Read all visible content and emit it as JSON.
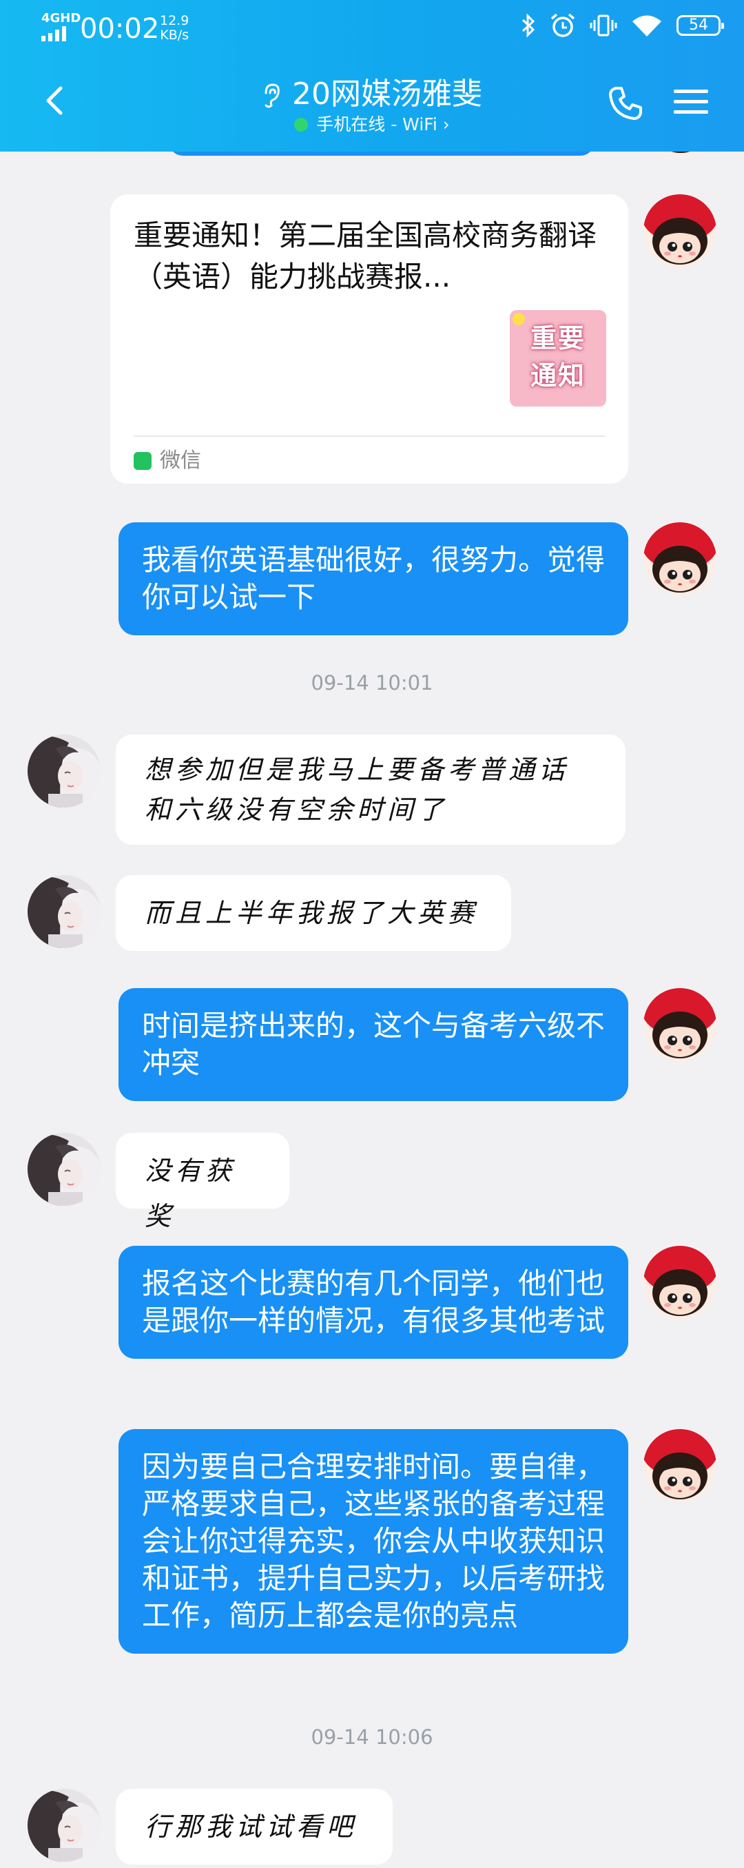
{
  "status_bar": {
    "network": "4GHD",
    "time": "00:02",
    "speed_value": "12.9",
    "speed_unit": "KB/s",
    "battery": "54",
    "icons": [
      "bluetooth-icon",
      "alarm-icon",
      "vibrate-icon",
      "wifi-icon",
      "battery-icon"
    ]
  },
  "header": {
    "title": "20网媒汤雅斐",
    "subtitle": "手机在线 - WiFi",
    "chevron": "›",
    "accent": "#16b9f2",
    "online_color": "#32d86a"
  },
  "messages": [
    {
      "type": "card",
      "side": "right",
      "title": "重要通知！第二届全国高校商务翻译（英语）能力挑战赛报...",
      "thumb_text": "重要通知",
      "source": "微信"
    },
    {
      "type": "text",
      "side": "right",
      "text": "我看你英语基础很好，很努力。觉得你可以试一下"
    },
    {
      "type": "time",
      "text": "09-14 10:01"
    },
    {
      "type": "text",
      "side": "left",
      "text": "想参加但是我马上要备考普通话和六级没有空余时间了"
    },
    {
      "type": "text",
      "side": "left",
      "text": "而且上半年我报了大英赛"
    },
    {
      "type": "text",
      "side": "right",
      "text": "时间是挤出来的，这个与备考六级不冲突"
    },
    {
      "type": "text",
      "side": "left",
      "text": "没有获奖"
    },
    {
      "type": "text",
      "side": "right",
      "text": "报名这个比赛的有几个同学，他们也是跟你一样的情况，有很多其他考试"
    },
    {
      "type": "text",
      "side": "right",
      "text": "因为要自己合理安排时间。要自律，严格要求自己，这些紧张的备考过程会让你过得充实，你会从中收获知识和证书，提升自己实力，以后考研找工作，简历上都会是你的亮点"
    },
    {
      "type": "time",
      "text": "09-14 10:06"
    },
    {
      "type": "text",
      "side": "left",
      "text": "行那我试试看吧"
    }
  ],
  "colors": {
    "bubble_blue": "#1890f5",
    "background": "#f1f1f3",
    "bubble_white": "#ffffff"
  }
}
